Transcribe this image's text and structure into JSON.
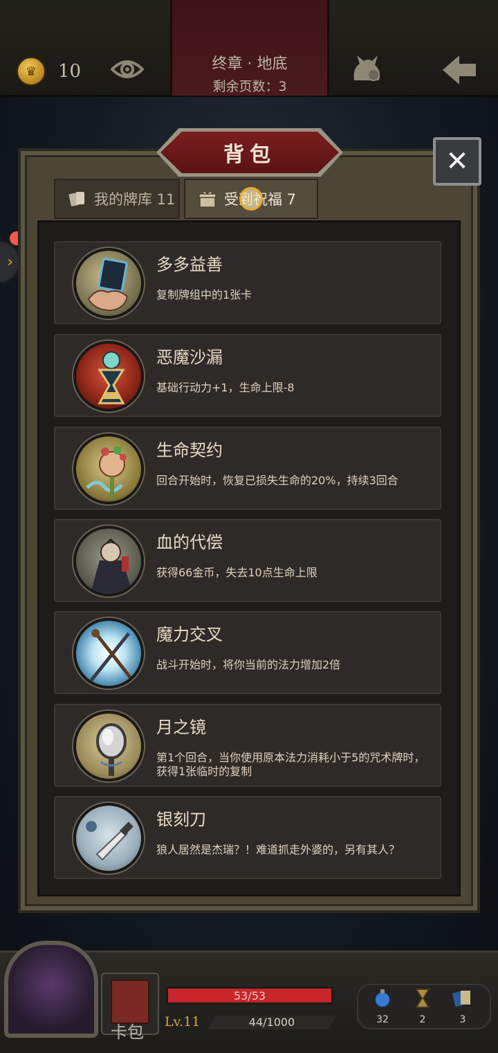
{
  "topbar": {
    "coins": "10",
    "chapter_title": "终章 · 地底",
    "pages_left": "剩余页数：3"
  },
  "panel": {
    "title": "背包",
    "close_label": "✕",
    "tabs": [
      {
        "label": "我的牌库 11",
        "active": false
      },
      {
        "label": "受到祝福 7",
        "active": true
      }
    ]
  },
  "blessings": [
    {
      "name": "多多益善",
      "desc": "复制牌组中的1张卡",
      "icon": "hand-card-icon"
    },
    {
      "name": "恶魔沙漏",
      "desc": "基础行动力+1，生命上限-8",
      "icon": "demon-hourglass-icon"
    },
    {
      "name": "生命契约",
      "desc": "回合开始时，恢复已损失生命的20%，持续3回合",
      "icon": "life-pact-icon"
    },
    {
      "name": "血的代偿",
      "desc": "获得66金币，失去10点生命上限",
      "icon": "vampire-icon"
    },
    {
      "name": "魔力交叉",
      "desc": "战斗开始时，将你当前的法力增加2倍",
      "icon": "crossed-staves-icon"
    },
    {
      "name": "月之镜",
      "desc": "第1个回合，当你使用原本法力消耗小于5的咒术牌时，获得1张临时的复制",
      "icon": "moon-mirror-icon"
    },
    {
      "name": "银刻刀",
      "desc": "狼人居然是杰瑞？！难道抓走外婆的，另有其人？",
      "icon": "silver-knife-icon"
    }
  ],
  "bottombar": {
    "cardpack_label": "卡包",
    "hp_text": "53/53",
    "hp_fraction": 1.0,
    "level": "Lv.11",
    "xp_text": "44/1000",
    "resources": [
      {
        "icon": "potion-icon",
        "count": "32"
      },
      {
        "icon": "hourglass-icon",
        "count": "2"
      },
      {
        "icon": "cards-icon",
        "count": "3"
      }
    ]
  },
  "colors": {
    "accent_red": "#7a1e1f",
    "gold": "#d2a73d",
    "hp_red": "#c8262b"
  }
}
